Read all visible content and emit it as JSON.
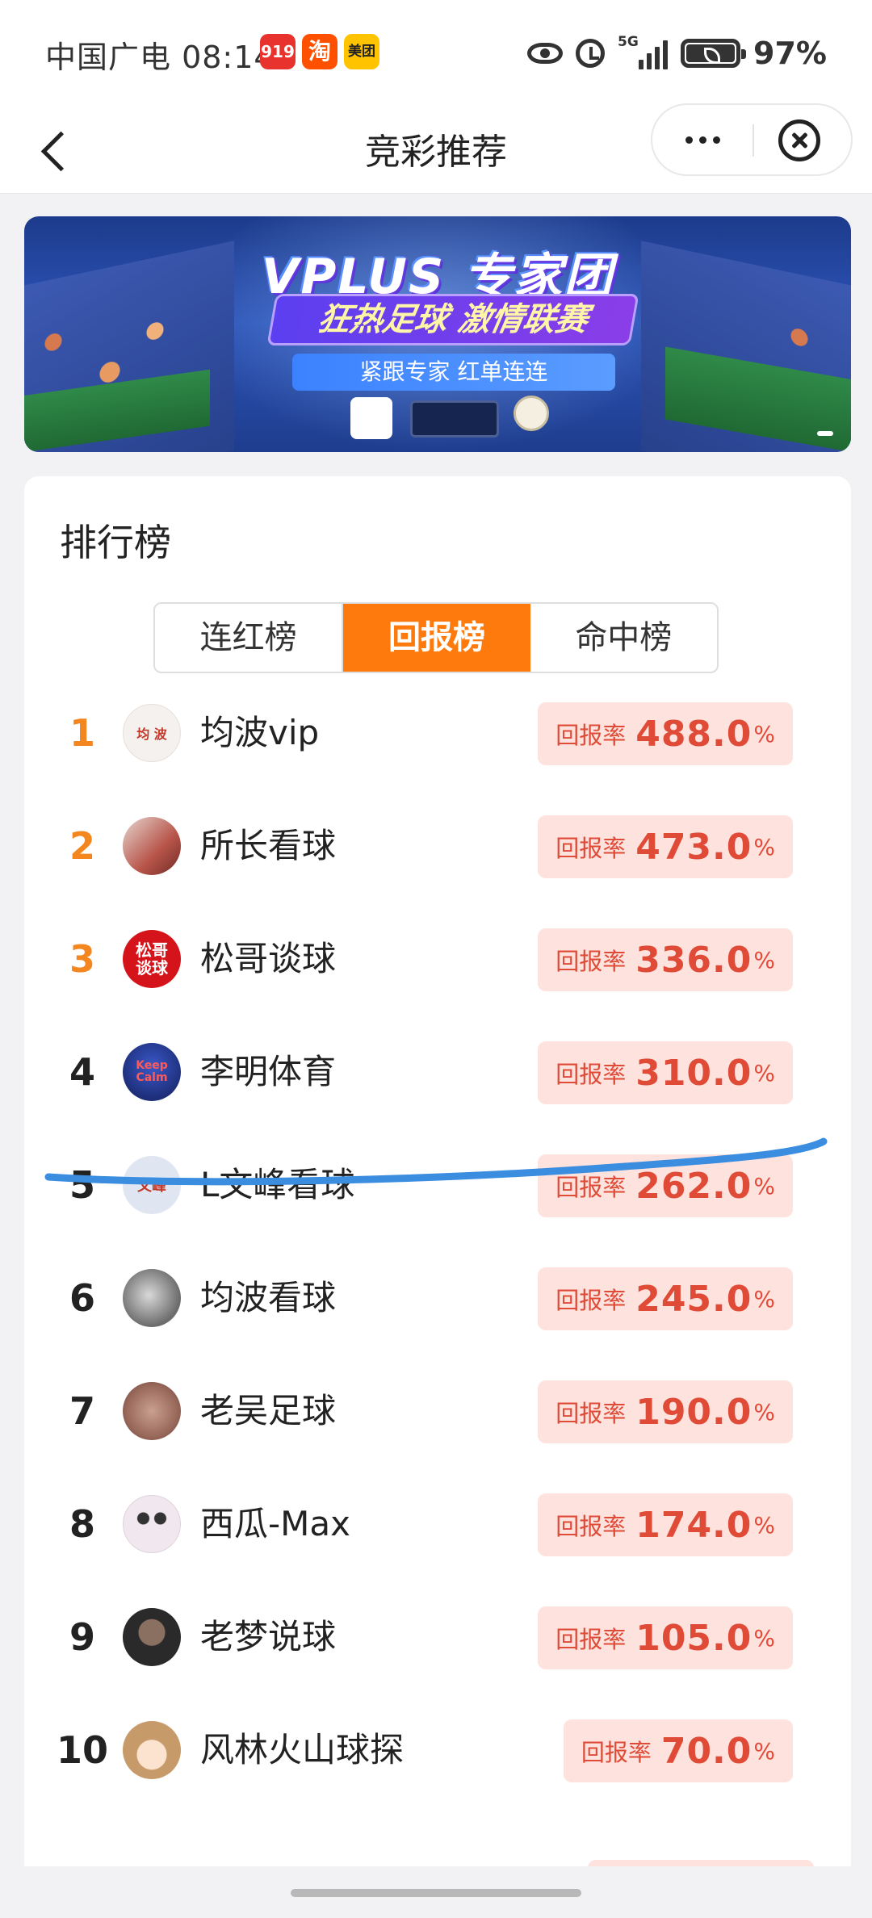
{
  "status_bar": {
    "carrier_time": "中国广电 08:14",
    "apps": [
      {
        "icon": "huodong-app-icon",
        "label": "919",
        "color": "#e8322e"
      },
      {
        "icon": "taobao-app-icon",
        "label": "淘",
        "color": "#ff5000"
      },
      {
        "icon": "meituan-app-icon",
        "label": "美团",
        "color": "#ffc300"
      }
    ],
    "network": "5G",
    "battery_percent": "97%",
    "battery_level": 0.97
  },
  "nav": {
    "title": "竞彩推荐",
    "back_icon": "chevron-left-icon",
    "more_icon": "more-dots-icon",
    "close_icon": "close-circle-icon"
  },
  "banner": {
    "title": "VPLUS 专家团",
    "subtitle": "狂热足球 激情联赛",
    "slogan": "紧跟专家 红单连连"
  },
  "ranking": {
    "title": "排行榜",
    "tabs": [
      {
        "label": "连红榜",
        "active": false
      },
      {
        "label": "回报榜",
        "active": true
      },
      {
        "label": "命中榜",
        "active": false
      }
    ],
    "rate_label": "回报率",
    "percent_sign": "%",
    "rows": [
      {
        "rank": "1",
        "name": "均波vip",
        "rate": "488.0",
        "avatar_color": "#f4f1ee",
        "avatar_text": "均 波"
      },
      {
        "rank": "2",
        "name": "所长看球",
        "rate": "473.0",
        "avatar_color": "#b9554a",
        "avatar_text": ""
      },
      {
        "rank": "3",
        "name": "松哥谈球",
        "rate": "336.0",
        "avatar_color": "#d4141a",
        "avatar_text": "松哥 谈球"
      },
      {
        "rank": "4",
        "name": "李明体育",
        "rate": "310.0",
        "avatar_color": "#c4343e",
        "avatar_text": "Keep Calm"
      },
      {
        "rank": "5",
        "name": "L文峰看球",
        "rate": "262.0",
        "avatar_color": "#dfe6f2",
        "avatar_text": "文峰"
      },
      {
        "rank": "6",
        "name": "均波看球",
        "rate": "245.0",
        "avatar_color": "#e9e9e9",
        "avatar_text": ""
      },
      {
        "rank": "7",
        "name": "老吴足球",
        "rate": "190.0",
        "avatar_color": "#9a6a5c",
        "avatar_text": ""
      },
      {
        "rank": "8",
        "name": "西瓜-Max",
        "rate": "174.0",
        "avatar_color": "#f0e8ee",
        "avatar_text": ""
      },
      {
        "rank": "9",
        "name": "老梦说球",
        "rate": "105.0",
        "avatar_color": "#2a2a2a",
        "avatar_text": ""
      },
      {
        "rank": "10",
        "name": "风林火山球探",
        "rate": "70.0",
        "avatar_color": "#e8c8a0",
        "avatar_text": ""
      }
    ]
  },
  "colors": {
    "accent": "#ff7a0d",
    "rate_text": "#e04b37",
    "rate_bg": "#fde2de",
    "top_rank": "#f4861f",
    "annotation": "#3b8de0"
  }
}
